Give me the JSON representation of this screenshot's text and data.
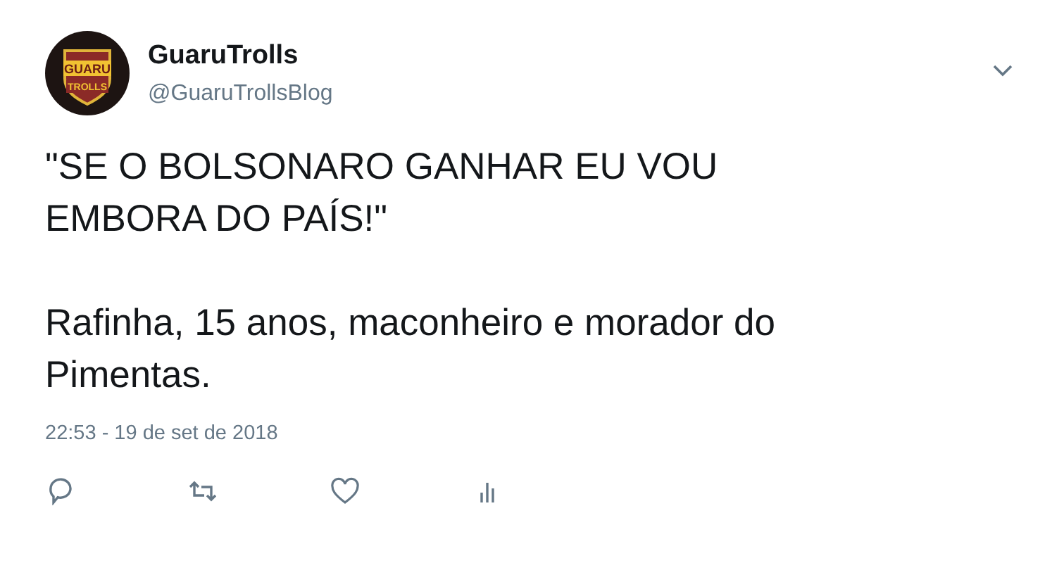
{
  "author": {
    "name": "GuaruTrolls",
    "handle": "@GuaruTrollsBlog",
    "logo_lines": [
      "GUARU",
      "TROLLS"
    ]
  },
  "tweet": {
    "text": "\"SE O BOLSONARO GANHAR EU VOU\nEMBORA DO PAÍS!\"\n\nRafinha, 15 anos, maconheiro e morador do\nPimentas.",
    "timestamp": "22:53 - 19 de set de 2018"
  },
  "actions": [
    {
      "kind": "reply"
    },
    {
      "kind": "retweet"
    },
    {
      "kind": "like"
    },
    {
      "kind": "analytics"
    }
  ]
}
